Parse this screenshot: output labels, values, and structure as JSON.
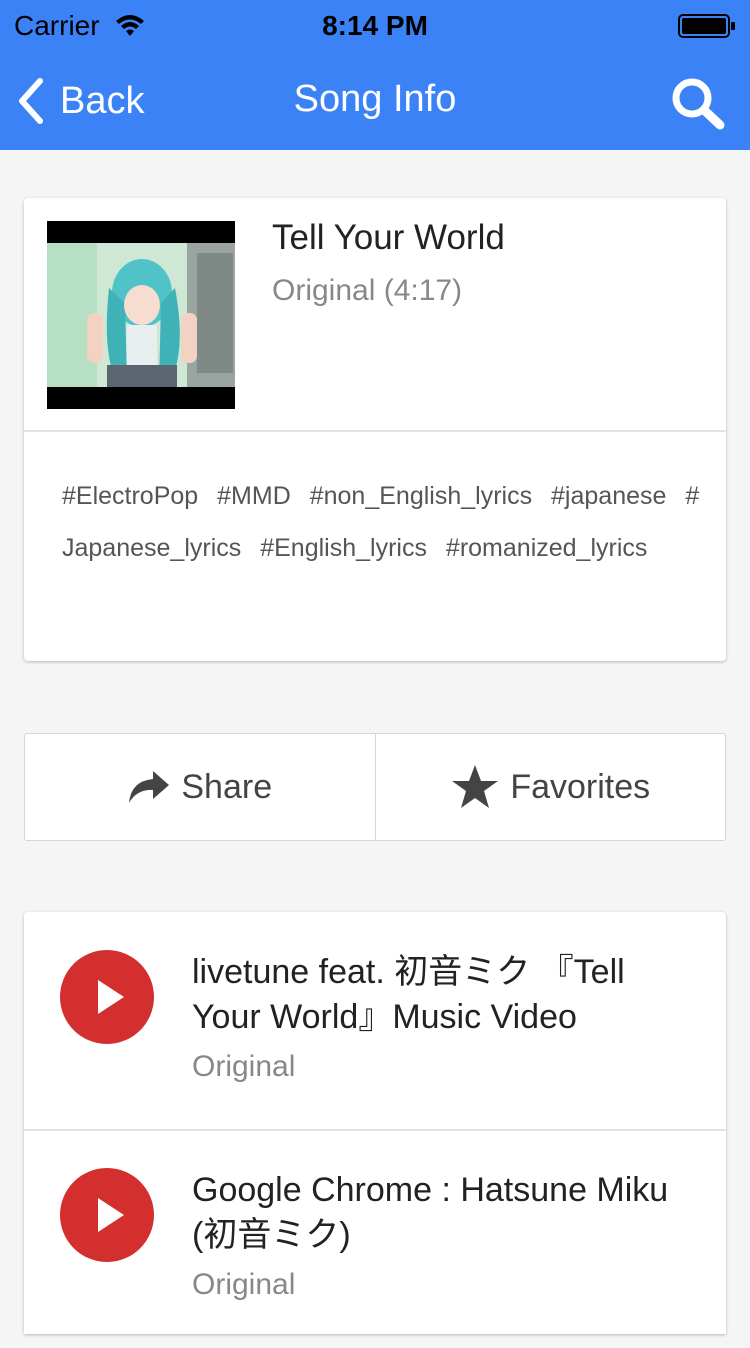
{
  "status_bar": {
    "carrier": "Carrier",
    "time": "8:14 PM"
  },
  "nav": {
    "back_label": "Back",
    "title": "Song Info"
  },
  "song": {
    "title": "Tell Your World",
    "subtitle": "Original (4:17)"
  },
  "tags": [
    "#ElectroPop",
    "#MMD",
    "#non_English_lyrics",
    "#japanese",
    "#Japanese_lyrics",
    "#English_lyrics",
    "#romanized_lyrics"
  ],
  "actions": {
    "share_label": "Share",
    "favorites_label": "Favorites"
  },
  "videos": [
    {
      "title": "livetune feat. 初音ミク 『Tell Your World』Music Video",
      "subtitle": "Original"
    },
    {
      "title": "Google Chrome : Hatsune Miku (初音ミク)",
      "subtitle": "Original"
    }
  ],
  "colors": {
    "nav_bar": "#3b82f6",
    "play_button": "#d32f2f",
    "background": "#f5f5f5"
  },
  "icons": [
    "wifi-icon",
    "battery-icon",
    "back-chevron-icon",
    "search-icon",
    "share-icon",
    "star-icon",
    "play-icon"
  ]
}
